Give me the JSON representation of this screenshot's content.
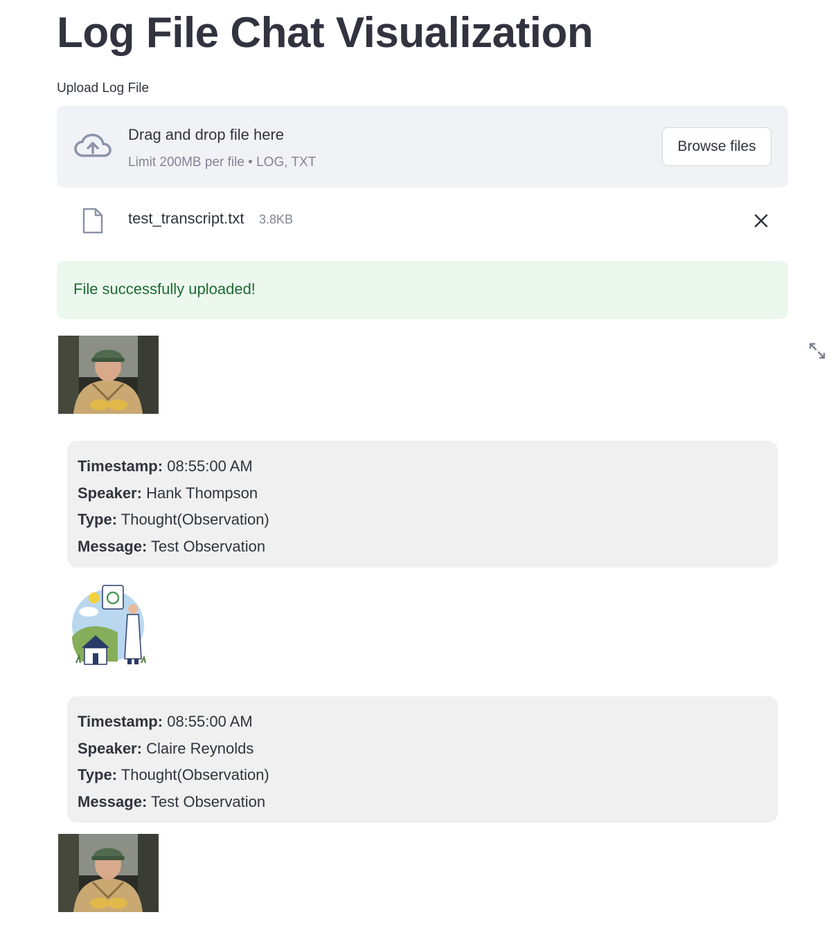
{
  "title": "Log File Chat Visualization",
  "uploader": {
    "label": "Upload Log File",
    "drop_title": "Drag and drop file here",
    "drop_subtitle": "Limit 200MB per file • LOG, TXT",
    "browse_label": "Browse files",
    "icon": "cloud-upload-icon"
  },
  "uploaded_file": {
    "name": "test_transcript.txt",
    "size": "3.8KB",
    "icon": "file-icon"
  },
  "status": {
    "message": "File successfully uploaded!",
    "color": "#1e6b33",
    "background": "#ecf8ee"
  },
  "labels": {
    "timestamp": "Timestamp:",
    "speaker": "Speaker:",
    "type": "Type:",
    "message": "Message:"
  },
  "messages": [
    {
      "avatar": "photo-avatar",
      "timestamp": "08:55:00 AM",
      "speaker": "Hank Thompson",
      "type": "Thought(Observation)",
      "message": "Test Observation"
    },
    {
      "avatar": "illustration-avatar",
      "timestamp": "08:55:00 AM",
      "speaker": "Claire Reynolds",
      "type": "Thought(Observation)",
      "message": "Test Observation"
    }
  ],
  "trailing_avatar": "photo-avatar"
}
